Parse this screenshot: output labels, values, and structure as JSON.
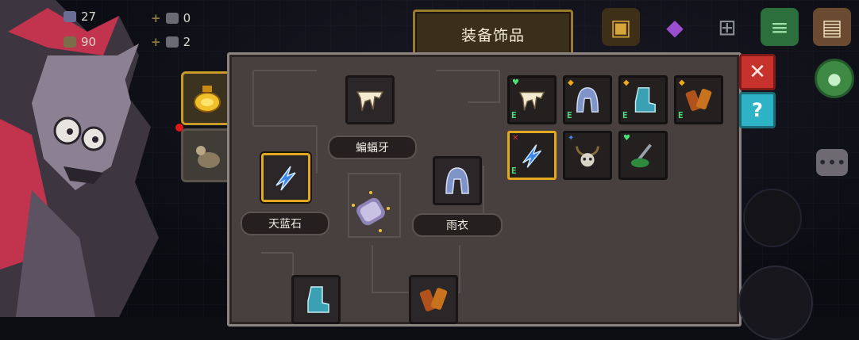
{
  "hud": {
    "gem_count": "27",
    "gold_count": "90",
    "item1_count": "0",
    "item2_count": "2",
    "plus": "+"
  },
  "header": {
    "title": "装备饰品"
  },
  "equipped": {
    "top": {
      "name": "蝙蝠牙",
      "icon": "fang-icon"
    },
    "left": {
      "name": "天蓝石",
      "icon": "blue-crystal-icon"
    },
    "right": {
      "name": "雨衣",
      "icon": "raincoat-icon"
    },
    "bottom_left": {
      "icon": "boot-icon"
    },
    "bottom_right": {
      "icon": "leather-gloves-icon"
    },
    "center": {
      "icon": "scroll-core-icon"
    }
  },
  "inventory": [
    {
      "icon": "fang-icon",
      "tag": "E",
      "mark": "heart"
    },
    {
      "icon": "raincoat-icon",
      "tag": "E",
      "mark": "gem"
    },
    {
      "icon": "boot-icon",
      "tag": "E",
      "mark": "gem"
    },
    {
      "icon": "leather-gloves-icon",
      "tag": "E",
      "mark": "gem"
    },
    {
      "icon": "blue-crystal-icon",
      "tag": "E",
      "mark": "cross",
      "selected": true
    },
    {
      "icon": "skull-necklace-icon",
      "tag": "",
      "mark": "star"
    },
    {
      "icon": "green-wand-icon",
      "tag": "",
      "mark": "heart"
    }
  ],
  "buttons": {
    "close": "✕",
    "help": "?"
  },
  "colors": {
    "accent_gold": "#e2a81e",
    "panel": "#47403f",
    "close_red": "#c8322c",
    "help_cyan": "#2eb2c6",
    "equip_tag_green": "#4fe07a"
  }
}
